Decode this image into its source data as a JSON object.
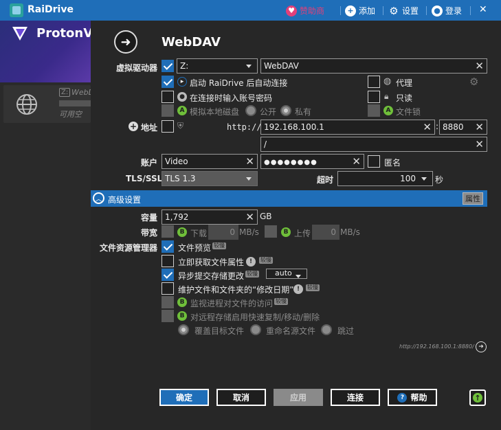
{
  "titlebar": {
    "app_title": "RaiDrive",
    "sponsor": "赞助商",
    "add": "添加",
    "settings": "设置",
    "login": "登录",
    "close": "✕"
  },
  "sidebar": {
    "banner_text": "ProtonVI",
    "drive_badge": "Z:",
    "drive_name": "WebD",
    "drive_free": "可用空"
  },
  "dialog": {
    "title": "WebDAV",
    "virtual_drive_label": "虚拟驱动器",
    "drive_letter": "Z:",
    "drive_name_value": "WebDAV",
    "auto_connect": "启动 RaiDrive 后自动连接",
    "proxy": "代理",
    "ask_credentials": "在连接时输入账号密码",
    "read_only": "只读",
    "simulate_local": "模拟本地磁盘",
    "public": "公开",
    "private": "私有",
    "file_lock": "文件锁",
    "address_label": "地址",
    "scheme": "http://",
    "host": "192.168.100.1",
    "port": "8880",
    "path": "/",
    "account_label": "账户",
    "username": "Video",
    "password": "●●●●●●●●",
    "anonymous": "匿名",
    "tls_label": "TLS/SSL",
    "tls_value": "TLS 1.3",
    "timeout_label": "超时",
    "timeout_value": "100",
    "timeout_unit": "秒",
    "advanced_label": "高级设置",
    "props_button": "属性",
    "capacity_label": "容量",
    "capacity_value": "1,792",
    "capacity_unit": "GB",
    "bandwidth_label": "带宽",
    "download": "下载",
    "download_value": "0",
    "download_unit": "MB/s",
    "upload": "上传",
    "upload_value": "0",
    "upload_unit": "MB/s",
    "explorer_label": "文件资源管理器",
    "file_preview": "文件预览",
    "fetch_attrs": "立即获取文件属性",
    "async_commit": "异步提交存储更改",
    "async_mode": "auto",
    "maintain_mtime": "维护文件和文件夹的“修改日期”",
    "monitor_access": "监视进程对文件的访问",
    "fast_copy": "对远程存储启用快速复制/移动/删除",
    "overwrite": "覆盖目标文件",
    "rename_source": "重命名源文件",
    "skip": "跳过",
    "beta_tag": "较慢",
    "url_preview": "http://192.168.100.1:8880/",
    "ok": "确定",
    "cancel": "取消",
    "apply": "应用",
    "connect": "连接",
    "help": "帮助"
  },
  "colors": {
    "accent": "#1f6eb8",
    "dialog_bg": "#272727",
    "sponsor": "#e0407a",
    "green_badge": "#6fbf3a"
  }
}
